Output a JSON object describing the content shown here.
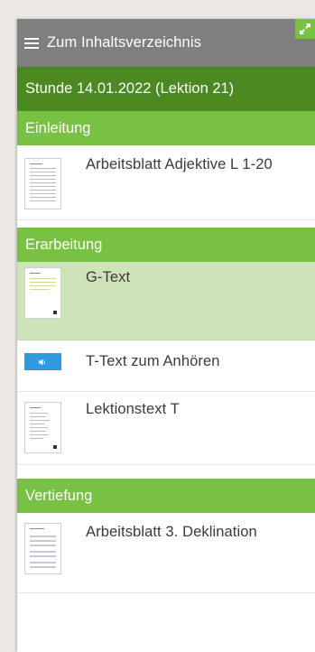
{
  "header": {
    "toc_label": "Zum Inhaltsverzeichnis",
    "menu_icon": "hamburger-menu-icon",
    "expand_icon": "expand-arrows-icon"
  },
  "lesson": {
    "title": "Stunde 14.01.2022 (Lektion 21)"
  },
  "sections": [
    {
      "title": "Einleitung",
      "items": [
        {
          "label": "Arbeitsblatt Adjektive L 1-20",
          "icon": "worksheet-thumbnail"
        }
      ]
    },
    {
      "title": "Erarbeitung",
      "items": [
        {
          "label": "G-Text",
          "icon": "document-thumbnail",
          "active": true
        },
        {
          "label": "T-Text zum Anhören",
          "icon": "audio-speaker-icon"
        },
        {
          "label": "Lektionstext T",
          "icon": "document-thumbnail"
        }
      ]
    },
    {
      "title": "Vertiefung",
      "items": [
        {
          "label": "Arbeitsblatt 3. Deklination",
          "icon": "worksheet-thumbnail"
        }
      ]
    }
  ],
  "colors": {
    "topbar": "#7f7f7f",
    "lesson_bar": "#4a8a20",
    "section_header": "#79c143",
    "active_item": "#cfe3b9",
    "audio_button": "#2f9ae0"
  }
}
